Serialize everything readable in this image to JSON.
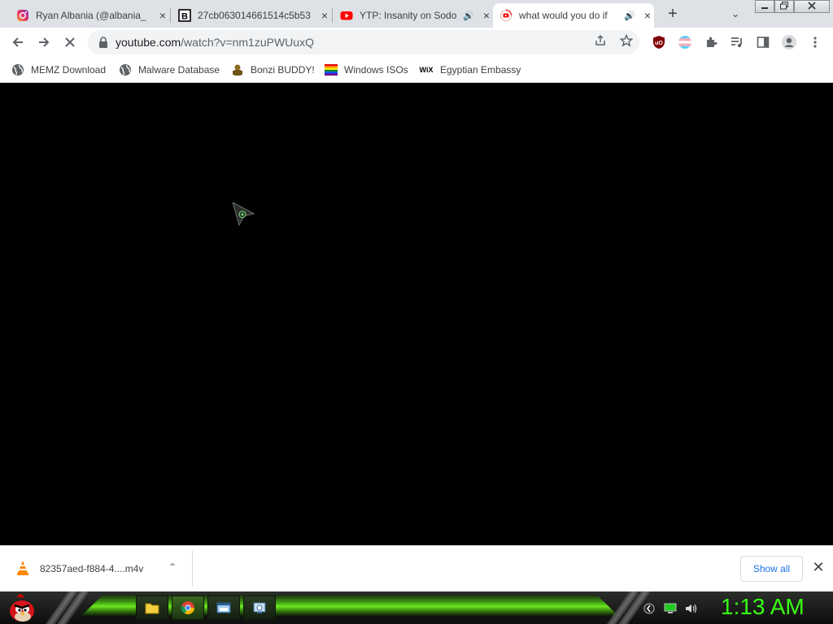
{
  "tabs": [
    {
      "title": "Ryan Albania (@albania_",
      "icon": "instagram-icon"
    },
    {
      "title": "27cb063014661514c5b53",
      "icon": "b-logo-icon"
    },
    {
      "title": "YTP: Insanity on Sodo",
      "icon": "youtube-icon",
      "audio": "🔊"
    },
    {
      "title": "what would you do if",
      "icon": "youtube-loading-icon",
      "audio": "🔊",
      "active": true
    }
  ],
  "tab_close": "×",
  "new_tab": "+",
  "tab_search": "⌄",
  "omnibox": {
    "host": "youtube.com",
    "path": "/watch?v=nm1zuPWUuxQ"
  },
  "bookmarks": [
    {
      "label": "MEMZ Download",
      "icon": "globe-icon"
    },
    {
      "label": "Malware Database",
      "icon": "globe-icon"
    },
    {
      "label": "Bonzi BUDDY!",
      "icon": "bonzi-icon"
    },
    {
      "label": "Windows ISOs",
      "icon": "rainbow-flag-icon"
    },
    {
      "label": "Egyptian Embassy",
      "icon": "wix-icon"
    }
  ],
  "bookmark_wix_text": "WiX",
  "download": {
    "filename": "82357aed-f884-4....m4v",
    "chevron": "⌃",
    "show_all": "Show all",
    "close": "✕"
  },
  "clock": "1:13 AM",
  "colors": {
    "clock": "#39ff14",
    "link": "#1a73e8",
    "taskbar_glow": "#6be81e"
  }
}
